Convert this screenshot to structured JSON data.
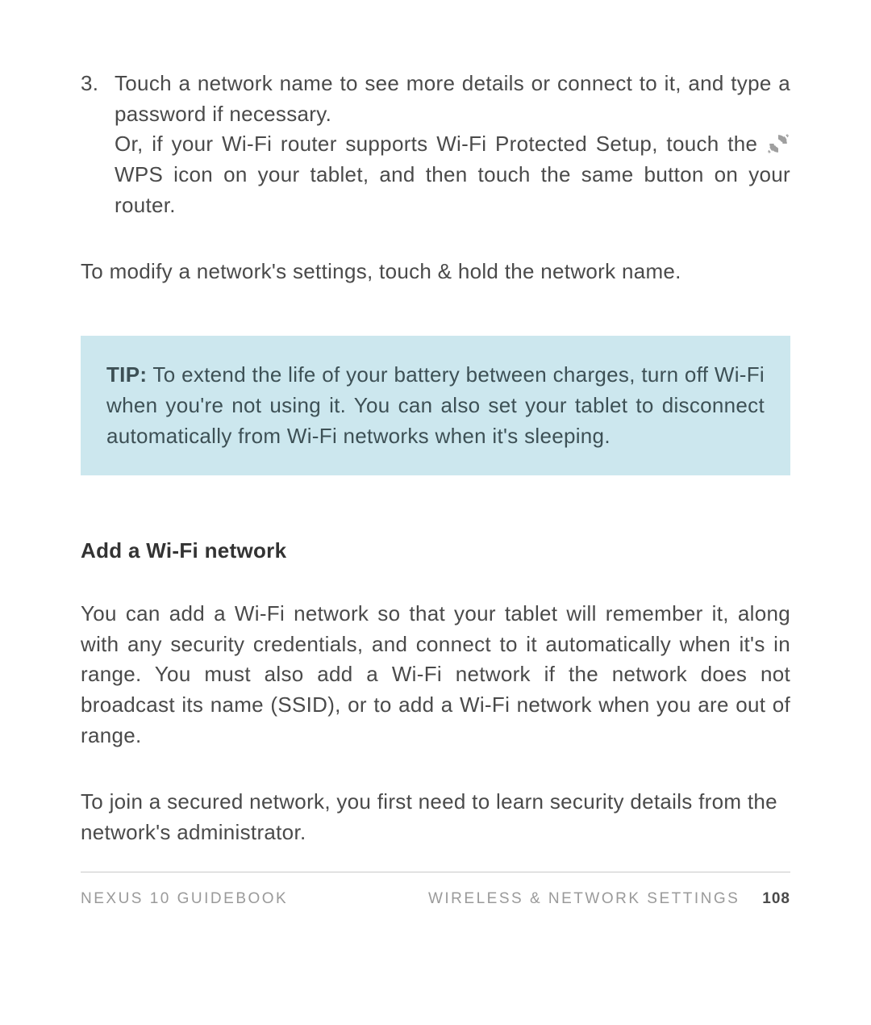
{
  "list_item": {
    "number": "3.",
    "line1": "Touch a network name to see more details or connect to it, and type a password if necessary.",
    "line2_before_icon": "Or, if your Wi-Fi router supports Wi-Fi Protected Setup, touch the ",
    "line2_after_icon": " WPS icon on your tablet, and then touch the same but­ton on your router."
  },
  "modify_para": "To modify a network's settings, touch & hold the network name.",
  "tip": {
    "label": "TIP:",
    "body": " To extend the life of your battery between charges, turn off Wi-Fi when you're not using it. You can also set your tab­let to disconnect automatically from Wi-Fi networks when it's sleeping."
  },
  "heading": "Add a Wi-Fi network",
  "add_para1": "You can add a Wi-Fi network so that your tablet will remember it, along with any security credentials, and connect to it automati­cally when it's in range. You must also add a Wi-Fi network if the network does not broadcast its name (SSID), or to add a Wi-Fi net­work when you are out of range.",
  "add_para2": "To join a secured network, you first need to learn security details from the network's administrator.",
  "footer": {
    "left": "NEXUS 10 GUIDEBOOK",
    "right": "WIRELESS & NETWORK SETTINGS",
    "page": "108"
  }
}
